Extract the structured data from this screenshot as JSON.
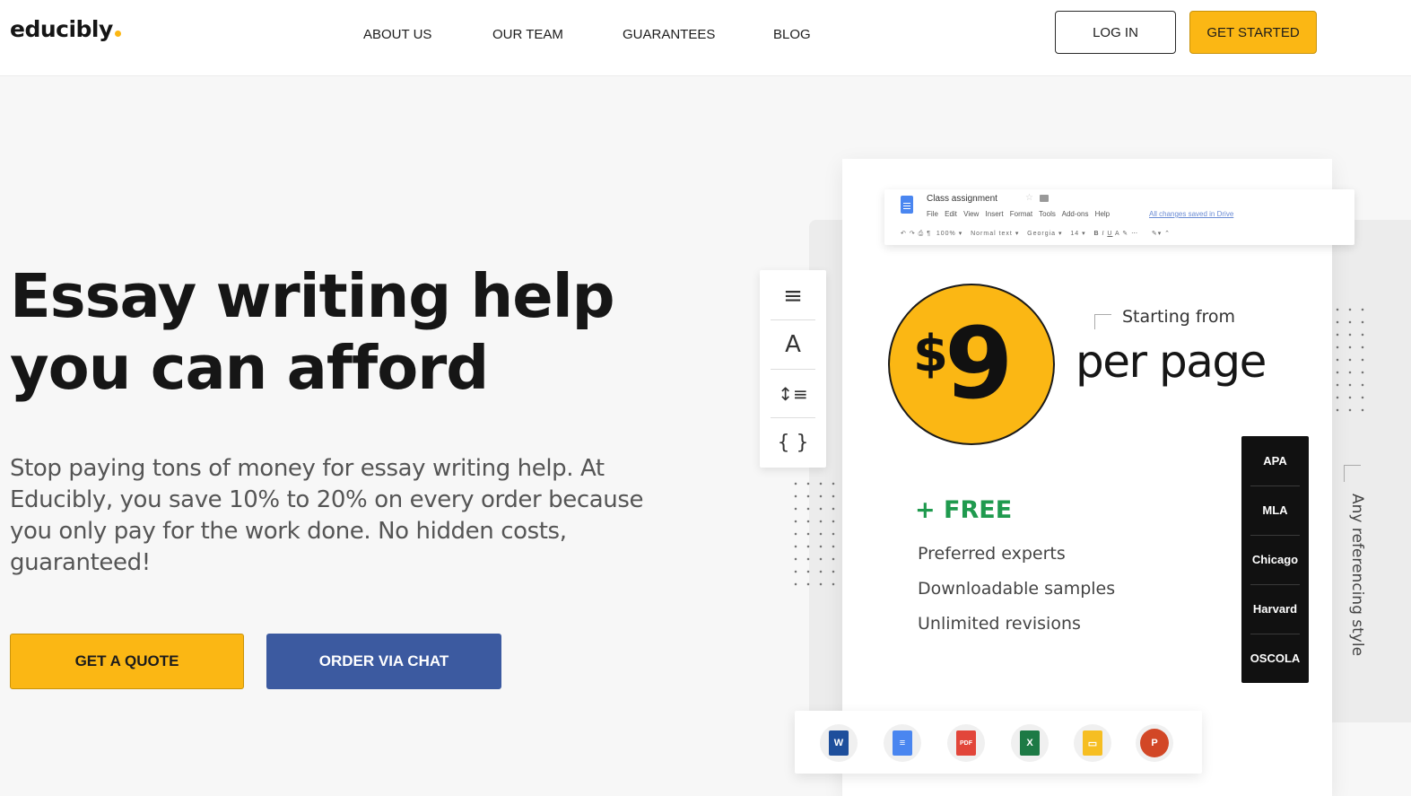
{
  "brand": {
    "name": "educibly",
    "accent": "#fbb714",
    "primary_blue": "#3c5aa0",
    "free_green": "#1f9a4e"
  },
  "nav": {
    "items": [
      "ABOUT US",
      "OUR TEAM",
      "GUARANTEES",
      "BLOG"
    ],
    "login_label": "LOG IN",
    "get_started_label": "GET STARTED"
  },
  "hero": {
    "title_line1": "Essay writing help",
    "title_line2": "you can afford",
    "subtitle": "Stop paying tons of money for essay writing help. At Educibly, you save 10% to 20% on every order because you only pay for the work done. No hidden costs, guaranteed!",
    "quote_button": "GET A QUOTE",
    "chat_button": "ORDER VIA CHAT"
  },
  "editor": {
    "doc_title": "Class assignment",
    "menu": "File Edit View Insert Format Tools Add-ons Help",
    "saved_status": "All changes saved in Drive",
    "zoom": "100%",
    "style": "Normal text",
    "font": "Georgia",
    "font_size": "14"
  },
  "side_tools": [
    {
      "icon": "align-left-icon",
      "glyph": "≡"
    },
    {
      "icon": "font-icon",
      "glyph": "A"
    },
    {
      "icon": "line-spacing-icon",
      "glyph": "↕≡"
    },
    {
      "icon": "braces-icon",
      "glyph": "{ }"
    }
  ],
  "pricing": {
    "currency": "$",
    "amount": "9",
    "starting_from": "Starting from",
    "unit": "per page"
  },
  "free": {
    "label": "+ FREE",
    "items": [
      "Preferred experts",
      "Downloadable samples",
      "Unlimited revisions"
    ]
  },
  "referencing": {
    "styles": [
      "APA",
      "MLA",
      "Chicago",
      "Harvard",
      "OSCOLA"
    ],
    "caption": "Any referencing style"
  },
  "formats": [
    {
      "icon": "word-icon",
      "label": "W",
      "color": "#1e4f9c"
    },
    {
      "icon": "google-docs-icon",
      "label": "",
      "color": "#4a86f0"
    },
    {
      "icon": "pdf-icon",
      "label": "PDF",
      "color": "#e2463a"
    },
    {
      "icon": "excel-icon",
      "label": "X",
      "color": "#1d7a45"
    },
    {
      "icon": "google-slides-icon",
      "label": "",
      "color": "#f6be22"
    },
    {
      "icon": "powerpoint-icon",
      "label": "P",
      "color": "#d24726"
    }
  ]
}
